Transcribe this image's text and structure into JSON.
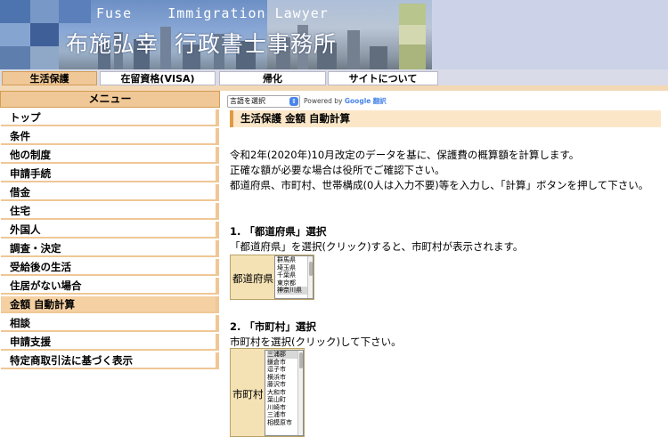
{
  "header": {
    "title_en": "Fuse    Immigration Lawyer",
    "title_ja": "布施弘幸  行政書士事務所"
  },
  "nav": {
    "tabs": [
      {
        "label": "生活保護",
        "active": true
      },
      {
        "label": "在留資格(VISA)",
        "active": false
      },
      {
        "label": "帰化",
        "active": false
      },
      {
        "label": "サイトについて",
        "active": false
      }
    ]
  },
  "sidebar": {
    "header": "メニュー",
    "items": [
      {
        "label": "トップ"
      },
      {
        "label": "条件"
      },
      {
        "label": "他の制度"
      },
      {
        "label": "申請手続"
      },
      {
        "label": "借金"
      },
      {
        "label": "住宅"
      },
      {
        "label": "外国人"
      },
      {
        "label": "調査・決定"
      },
      {
        "label": "受給後の生活"
      },
      {
        "label": "住居がない場合"
      },
      {
        "label": "金額 自動計算",
        "active": true
      },
      {
        "label": "相談"
      },
      {
        "label": "申請支援"
      },
      {
        "label": "特定商取引法に基づく表示"
      }
    ]
  },
  "translate": {
    "select_label": "言語を選択",
    "powered_by": "Powered by",
    "google": "Google",
    "translate": "翻訳"
  },
  "main": {
    "title": "生活保護 金額 自動計算",
    "intro": [
      "令和2年(2020年)10月改定のデータを基に、保護費の概算額を計算します。",
      "正確な額が必要な場合は役所でご確認下さい。",
      "都道府県、市町村、世帯構成(0人は入力不要)等を入力し、「計算」ボタンを押して下さい。"
    ],
    "section1": {
      "heading": "1. 「都道府県」選択",
      "instruction": "「都道府県」を選択(クリック)すると、市町村が表示されます。",
      "label": "都道府県",
      "options": [
        "群馬県",
        "埼玉県",
        "千葉県",
        "東京都",
        "神奈川県"
      ],
      "selected": "神奈川県"
    },
    "section2": {
      "heading": "2. 「市町村」選択",
      "instruction": "市町村を選択(クリック)して下さい。",
      "label": "市町村",
      "options": [
        "三浦郡",
        "鎌倉市",
        "逗子市",
        "横浜市",
        "藤沢市",
        "大和市",
        "葉山町",
        "川崎市",
        "三浦市",
        "相模原市"
      ],
      "selected": "三浦郡"
    }
  },
  "colors": {
    "accent": "#f0c796",
    "accent_border": "#d49c55",
    "title_bg": "#fbe7c8",
    "select_bg": "#f4e2b4"
  }
}
